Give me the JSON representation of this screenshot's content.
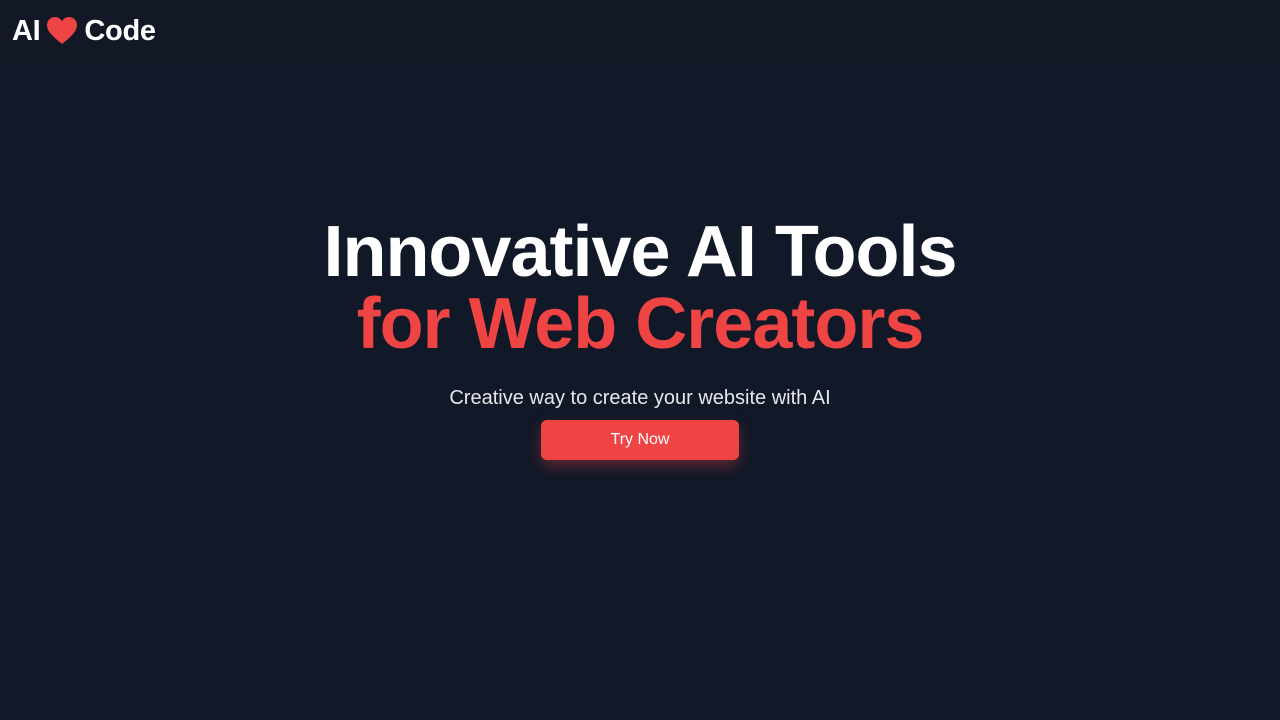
{
  "header": {
    "logo_left": "AI",
    "logo_icon": "heart-icon",
    "logo_right": "Code"
  },
  "hero": {
    "line1": "Innovative AI Tools",
    "line2": "for Web Creators",
    "subtitle": "Creative way to create your website with AI",
    "cta_label": "Try Now"
  },
  "colors": {
    "background": "#111827",
    "accent": "#ef4444",
    "text": "#ffffff",
    "subtext": "#e5e7eb"
  }
}
